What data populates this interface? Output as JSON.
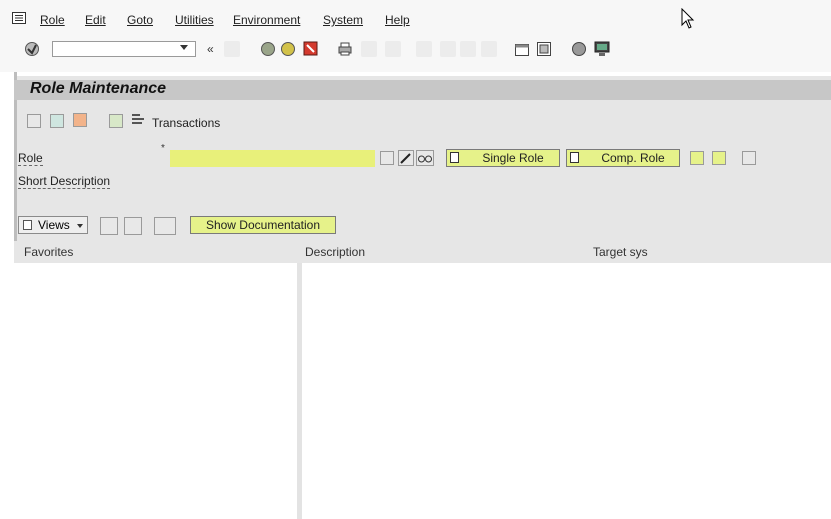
{
  "menu": {
    "items": [
      "Role",
      "Edit",
      "Goto",
      "Utilities",
      "Environment",
      "System",
      "Help"
    ]
  },
  "toolbar": {
    "command_field": {
      "value": "",
      "placeholder": ""
    },
    "clear_symbol": "«"
  },
  "page": {
    "title": "Role Maintenance"
  },
  "app_toolbar": {
    "transactions_label": "Transactions"
  },
  "form": {
    "role_label": "Role",
    "role_value": "",
    "short_description_label": "Short Description",
    "single_role_label": "Single Role",
    "comp_role_label": "Comp. Role"
  },
  "lower_toolbar": {
    "views_label": "Views",
    "show_documentation_label": "Show Documentation"
  },
  "table": {
    "columns": [
      "Favorites",
      "Description",
      "Target sys"
    ]
  },
  "colors": {
    "required_field": "#e8f07a",
    "button_yellow": "#e6f28a",
    "panel_gray": "#e6e6e6",
    "title_band": "#c7c7c7"
  }
}
